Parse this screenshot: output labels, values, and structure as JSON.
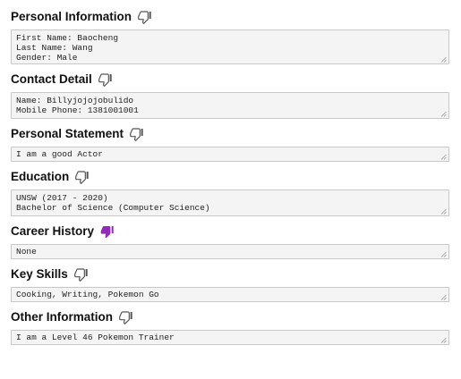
{
  "icons": {
    "unselected": "thumbs-down-outline-icon",
    "selected": "thumbs-down-filled-icon",
    "selected_color": "#8e2bb8",
    "unselected_color": "#555555"
  },
  "sections": [
    {
      "title": "Personal Information",
      "disliked": false,
      "content": "First Name: Baocheng\nLast Name: Wang\nGender: Male"
    },
    {
      "title": "Contact Detail",
      "disliked": false,
      "content": "Name: Billyjojojobulido\nMobile Phone: 1381001001"
    },
    {
      "title": "Personal Statement",
      "disliked": false,
      "content": "I am a good Actor"
    },
    {
      "title": "Education",
      "disliked": false,
      "content": "UNSW (2017 - 2020)\nBachelor of Science (Computer Science)"
    },
    {
      "title": "Career History",
      "disliked": true,
      "content": "None"
    },
    {
      "title": "Key Skills",
      "disliked": false,
      "content": "Cooking, Writing, Pokemon Go"
    },
    {
      "title": "Other Information",
      "disliked": false,
      "content": "I am a Level 46 Pokemon Trainer"
    }
  ]
}
